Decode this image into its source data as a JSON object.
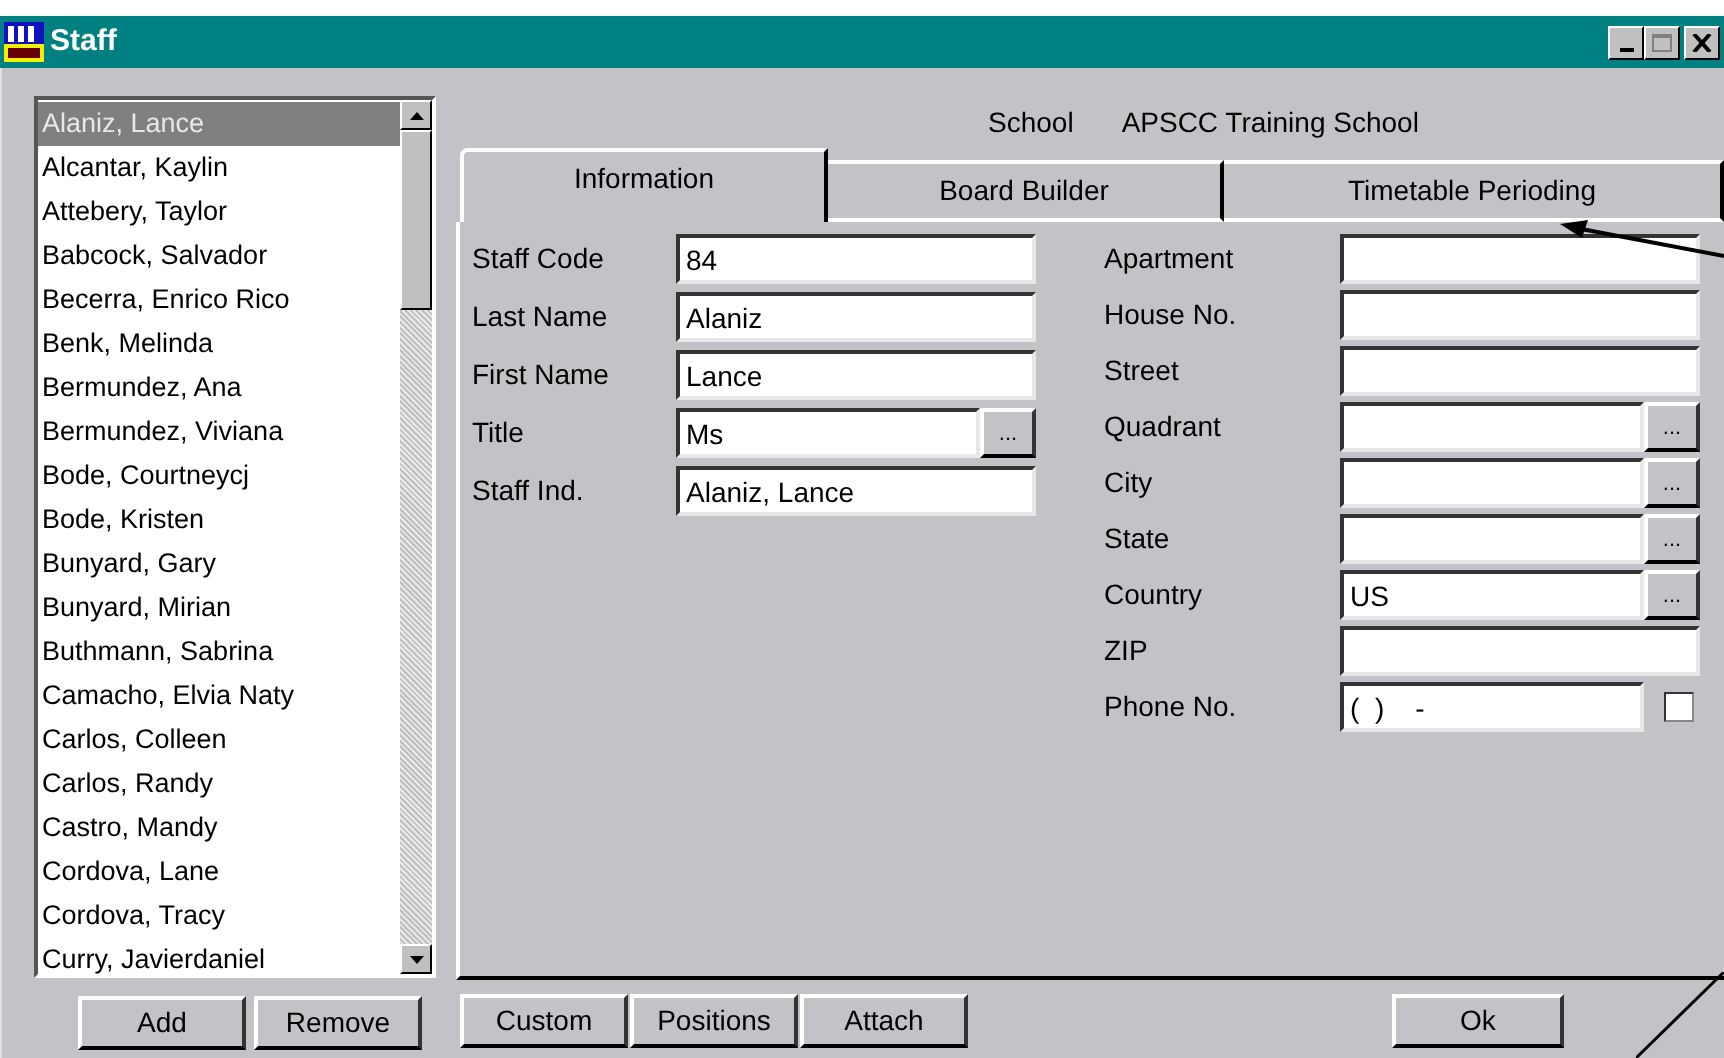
{
  "window": {
    "title": "Staff"
  },
  "staff_list": [
    {
      "name": "Alaniz, Lance",
      "selected": true
    },
    {
      "name": "Alcantar, Kaylin",
      "selected": false
    },
    {
      "name": "Attebery, Taylor",
      "selected": false
    },
    {
      "name": "Babcock, Salvador",
      "selected": false
    },
    {
      "name": "Becerra, Enrico Rico",
      "selected": false
    },
    {
      "name": "Benk, Melinda",
      "selected": false
    },
    {
      "name": "Bermundez, Ana",
      "selected": false
    },
    {
      "name": "Bermundez, Viviana",
      "selected": false
    },
    {
      "name": "Bode, Courtneycj",
      "selected": false
    },
    {
      "name": "Bode, Kristen",
      "selected": false
    },
    {
      "name": "Bunyard, Gary",
      "selected": false
    },
    {
      "name": "Bunyard, Mirian",
      "selected": false
    },
    {
      "name": "Buthmann, Sabrina",
      "selected": false
    },
    {
      "name": "Camacho, Elvia Naty",
      "selected": false
    },
    {
      "name": "Carlos, Colleen",
      "selected": false
    },
    {
      "name": "Carlos, Randy",
      "selected": false
    },
    {
      "name": "Castro, Mandy",
      "selected": false
    },
    {
      "name": "Cordova, Lane",
      "selected": false
    },
    {
      "name": "Cordova, Tracy",
      "selected": false
    },
    {
      "name": "Curry, Javierdaniel",
      "selected": false
    }
  ],
  "list_buttons": [
    "Add",
    "Remove"
  ],
  "school": {
    "label": "School",
    "value": "APSCC Training School"
  },
  "tabs": [
    {
      "label": "Information",
      "selected": true
    },
    {
      "label": "Board Builder",
      "selected": false
    },
    {
      "label": "Timetable Perioding",
      "selected": false
    }
  ],
  "left_fields": [
    {
      "label": "Staff Code",
      "value": "84",
      "kind": "text"
    },
    {
      "label": "Last Name",
      "value": "Alaniz",
      "kind": "text"
    },
    {
      "label": "First Name",
      "value": "Lance",
      "kind": "text"
    },
    {
      "label": "Title",
      "value": "Ms",
      "kind": "lookup",
      "button": "..."
    },
    {
      "label": "Staff Ind.",
      "value": "Alaniz, Lance",
      "kind": "text"
    }
  ],
  "right_fields": [
    {
      "label": "Apartment",
      "kind": "text"
    },
    {
      "label": "House No.",
      "kind": "text"
    },
    {
      "label": "Street",
      "kind": "text"
    },
    {
      "label": "Quadrant",
      "kind": "lookup",
      "button": "..."
    },
    {
      "label": "City",
      "kind": "lookup",
      "button": "..."
    },
    {
      "label": "State",
      "kind": "lookup",
      "button": "..."
    },
    {
      "label": "Country",
      "value": "US",
      "kind": "lookup",
      "button": "..."
    },
    {
      "label": "ZIP",
      "kind": "text"
    },
    {
      "label": "Phone No.",
      "value": "(  )    -",
      "kind": "check",
      "checked": false
    }
  ],
  "bottom_buttons": [
    "Custom",
    "Positions",
    "Attach"
  ],
  "ok_button": "Ok"
}
